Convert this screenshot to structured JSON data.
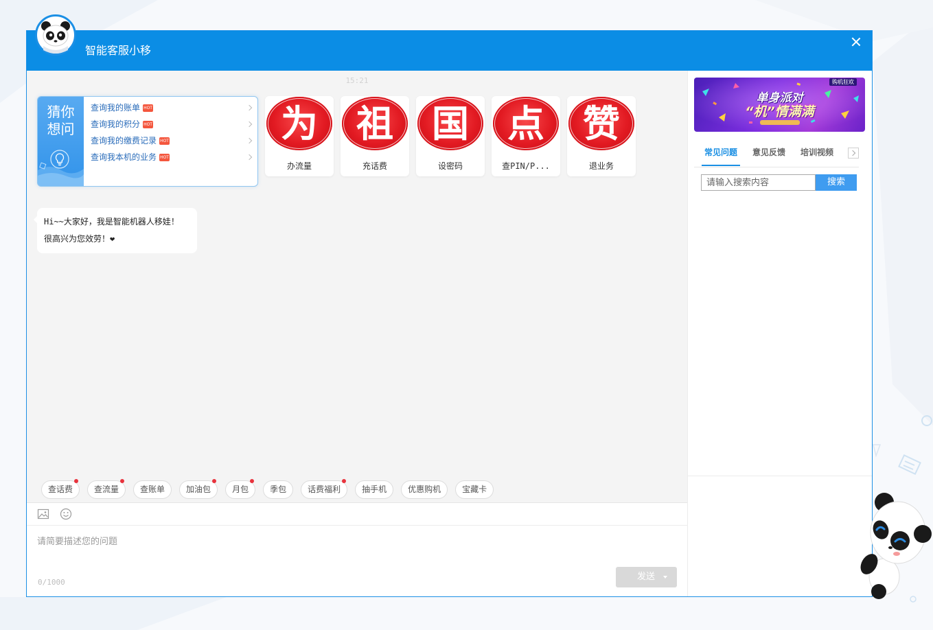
{
  "theme": {
    "accent": "#0b8de5",
    "hot_badge": "#f4563d",
    "tag_dot": "#e8323c",
    "seal_red": "#d8111b"
  },
  "window": {
    "title": "智能客服小移",
    "avatar_icon": "panda-robot-avatar-icon",
    "close_icon": "close-icon"
  },
  "chat": {
    "timestamp": "15:21",
    "guess": {
      "title_line1": "猜你",
      "title_line2": "想问",
      "icon": "lightbulb-icon",
      "items": [
        {
          "label": "查询我的账单",
          "badge": "HOT"
        },
        {
          "label": "查询我的积分",
          "badge": "HOT"
        },
        {
          "label": "查询我的缴费记录",
          "badge": "HOT"
        },
        {
          "label": "查询我本机的业务",
          "badge": "HOT"
        }
      ]
    },
    "services": [
      {
        "glyph": "为",
        "label": "办流量"
      },
      {
        "glyph": "祖",
        "label": "充话费"
      },
      {
        "glyph": "国",
        "label": "设密码"
      },
      {
        "glyph": "点",
        "label": "查PIN/P..."
      },
      {
        "glyph": "赞",
        "label": "退业务"
      }
    ],
    "messages": [
      {
        "sender": "bot",
        "lines": [
          "Hi~~大家好，我是智能机器人移娃！",
          "很高兴为您效劳！❤"
        ]
      }
    ]
  },
  "quick_tags": [
    {
      "label": "查话费",
      "dot": true
    },
    {
      "label": "查流量",
      "dot": true
    },
    {
      "label": "查账单",
      "dot": false
    },
    {
      "label": "加油包",
      "dot": true
    },
    {
      "label": "月包",
      "dot": true
    },
    {
      "label": "季包",
      "dot": false
    },
    {
      "label": "话费福利",
      "dot": true
    },
    {
      "label": "抽手机",
      "dot": false
    },
    {
      "label": "优惠购机",
      "dot": false
    },
    {
      "label": "宝藏卡",
      "dot": false
    }
  ],
  "toolbar": {
    "icons": [
      "image-icon",
      "emoji-icon"
    ]
  },
  "composer": {
    "placeholder": "请简要描述您的问题",
    "value": "",
    "counter": "0/1000",
    "send_label": "发送",
    "send_menu_icon": "caret-down-icon"
  },
  "sidebar": {
    "banner": {
      "corner_tag": "购机狂欢",
      "headline": "单身派对",
      "subline": "“机”情满满"
    },
    "tabs": [
      {
        "label": "常见问题",
        "active": true
      },
      {
        "label": "意见反馈",
        "active": false
      },
      {
        "label": "培训视频",
        "active": false
      }
    ],
    "tabs_next_icon": "chevron-right-icon",
    "search": {
      "placeholder": "请输入搜索内容",
      "value": "",
      "button_label": "搜索"
    }
  },
  "mascot": {
    "icon": "panda-mascot-icon"
  }
}
